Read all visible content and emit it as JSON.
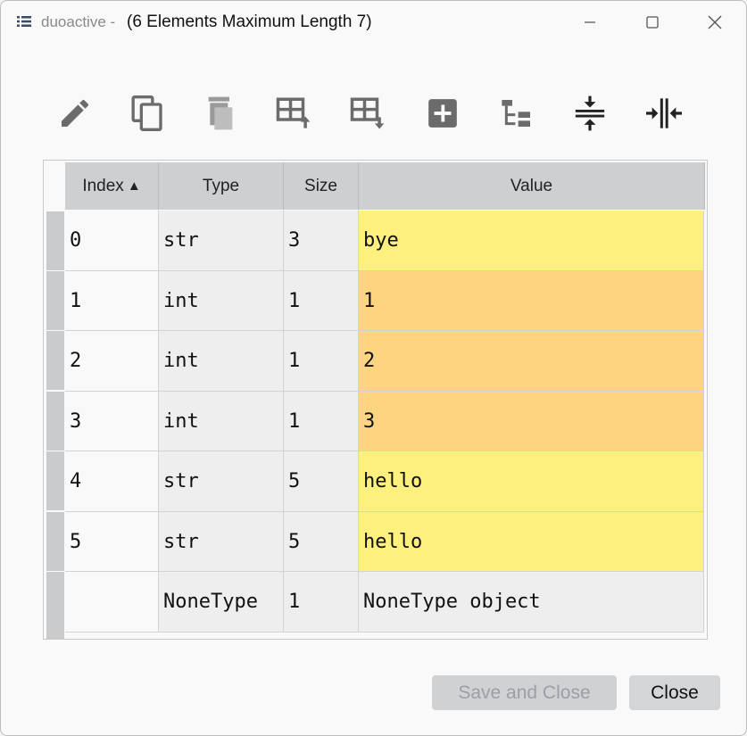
{
  "window": {
    "app_name": "duoactive",
    "title_separator": "-",
    "title": "(6 Elements Maximum Length 7)"
  },
  "toolbar": {
    "icons": [
      "edit-icon",
      "copy-icon",
      "delete-icon",
      "insert-above-icon",
      "insert-below-icon",
      "add-icon",
      "tree-icon",
      "collapse-icon",
      "expand-icon"
    ]
  },
  "table": {
    "columns": [
      "Index",
      "Type",
      "Size",
      "Value"
    ],
    "sort_indicator": "▲",
    "rows": [
      {
        "index": "0",
        "type": "str",
        "size": "3",
        "value": "bye"
      },
      {
        "index": "1",
        "type": "int",
        "size": "1",
        "value": "1"
      },
      {
        "index": "2",
        "type": "int",
        "size": "1",
        "value": "2"
      },
      {
        "index": "3",
        "type": "int",
        "size": "1",
        "value": "3"
      },
      {
        "index": "4",
        "type": "str",
        "size": "5",
        "value": "hello"
      },
      {
        "index": "5",
        "type": "str",
        "size": "5",
        "value": "hello"
      },
      {
        "index": "",
        "type": "NoneType",
        "size": "1",
        "value": "NoneType object"
      }
    ]
  },
  "buttons": {
    "save_close": "Save and Close",
    "close": "Close"
  },
  "colors": {
    "str_value": "#fdf07f",
    "int_value": "#fdd480",
    "header": "#cdcfd1"
  }
}
